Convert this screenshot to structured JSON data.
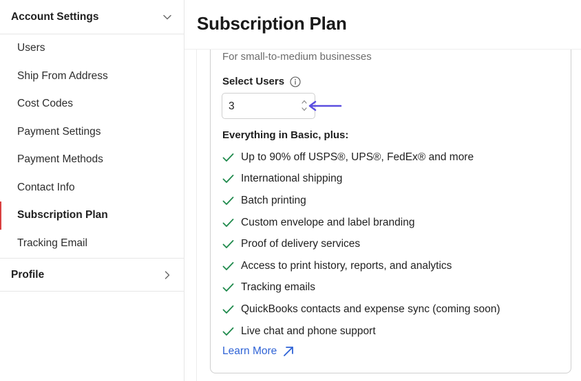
{
  "sidebar": {
    "account_settings": {
      "label": "Account Settings",
      "items": [
        {
          "label": "Users"
        },
        {
          "label": "Ship From Address"
        },
        {
          "label": "Cost Codes"
        },
        {
          "label": "Payment Settings"
        },
        {
          "label": "Payment Methods"
        },
        {
          "label": "Contact Info"
        },
        {
          "label": "Subscription Plan",
          "active": true
        },
        {
          "label": "Tracking Email"
        }
      ]
    },
    "profile": {
      "label": "Profile"
    }
  },
  "main": {
    "title": "Subscription Plan",
    "plan": {
      "description": "For small-to-medium businesses",
      "select_users_label": "Select Users",
      "users_value": "3",
      "features_heading": "Everything in Basic, plus:",
      "features": [
        "Up to 90% off USPS®, UPS®, FedEx® and more",
        "International shipping",
        "Batch printing",
        "Custom envelope and label branding",
        "Proof of delivery services",
        "Access to print history, reports, and analytics",
        "Tracking emails",
        "QuickBooks contacts and expense sync (coming soon)",
        "Live chat and phone support"
      ],
      "learn_more": "Learn More"
    }
  },
  "colors": {
    "active_indicator": "#d94040",
    "check": "#1f8a4c",
    "link": "#2f63d6",
    "annotation_arrow": "#5b4ee0"
  },
  "icons": {
    "account_settings_toggle": "chevron-down-icon",
    "profile_toggle": "chevron-right-icon",
    "info": "info-icon",
    "stepper": "up-down-arrows-icon",
    "feature": "check-icon",
    "learn_more": "external-arrow-icon",
    "annotation": "left-arrow-icon"
  }
}
